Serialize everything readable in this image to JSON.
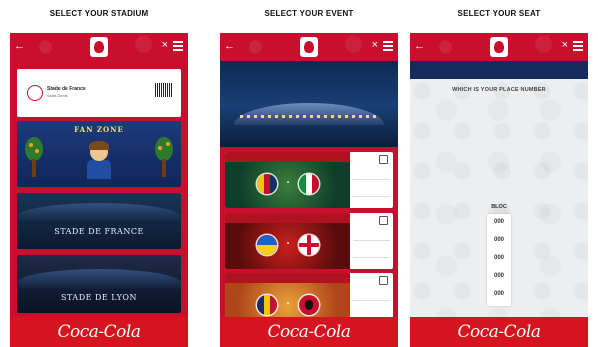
{
  "columns": [
    {
      "title": "SELECT YOUR STADIUM"
    },
    {
      "title": "SELECT YOUR EVENT"
    },
    {
      "title": "SELECT YOUR SEAT"
    }
  ],
  "brand": {
    "footer_logo": "Coca-Cola",
    "primary_color": "#c8102e",
    "navy_color": "#152b5c"
  },
  "stadium_screen": {
    "ticket": {
      "name": "Stade de France",
      "sub": "Saint-Denis"
    },
    "cards": [
      {
        "name": "FAN ZONE"
      },
      {
        "name": "STADE DE FRANCE"
      },
      {
        "name": "STADE DE LYON"
      }
    ]
  },
  "event_screen": {
    "matches": [
      {
        "home_colors": [
          "#f3c413",
          "#c8102e",
          "#1a2c6c"
        ],
        "away_colors": [
          "#1b8a3e",
          "#ffffff",
          "#c8102e"
        ]
      },
      {
        "home_colors": [
          "#1f5fc7",
          "#f7d117"
        ],
        "away_colors": [
          "#ffffff",
          "#c8102e"
        ]
      },
      {
        "home_colors": [
          "#1a2c6c",
          "#f3c413",
          "#c8102e"
        ],
        "away_colors": [
          "#c8102e",
          "#111111"
        ]
      }
    ]
  },
  "seat_screen": {
    "question": "WHICH IS YOUR PLACE NUMBER",
    "block_label": "BLOC",
    "seats": [
      "000",
      "000",
      "000",
      "000",
      "000"
    ]
  }
}
